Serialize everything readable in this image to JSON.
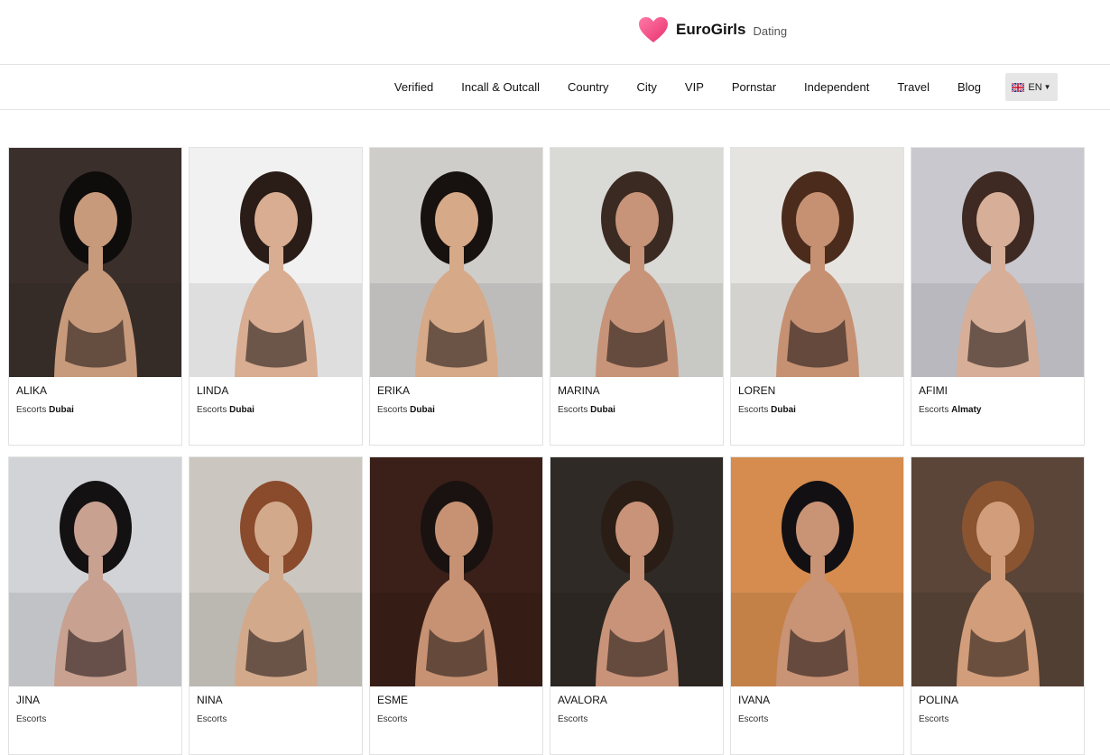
{
  "brand": {
    "name": "EuroGirls",
    "sub": "Dating"
  },
  "nav": {
    "items": [
      "Verified",
      "Incall & Outcall",
      "Country",
      "City",
      "VIP",
      "Pornstar",
      "Independent",
      "Travel",
      "Blog"
    ],
    "language": "EN"
  },
  "profiles": [
    {
      "name": "ALIKA",
      "prefix": "Escorts",
      "city": "Dubai",
      "bg": "#3a2f2b",
      "skin": "#c89a7c",
      "hair": "#0f0c0c"
    },
    {
      "name": "LINDA",
      "prefix": "Escorts",
      "city": "Dubai",
      "bg": "#f1f1f1",
      "skin": "#d8ad92",
      "hair": "#2a1c17"
    },
    {
      "name": "ERIKA",
      "prefix": "Escorts",
      "city": "Dubai",
      "bg": "#cfcdca",
      "skin": "#d6a988",
      "hair": "#17110f"
    },
    {
      "name": "MARINA",
      "prefix": "Escorts",
      "city": "Dubai",
      "bg": "#d9d9d6",
      "skin": "#c79479",
      "hair": "#3a2a22"
    },
    {
      "name": "LOREN",
      "prefix": "Escorts",
      "city": "Dubai",
      "bg": "#e6e4e0",
      "skin": "#c69173",
      "hair": "#4a2b1c"
    },
    {
      "name": "AFIMI",
      "prefix": "Escorts",
      "city": "Almaty",
      "bg": "#c9c8cf",
      "skin": "#d7ae97",
      "hair": "#3e2a22"
    },
    {
      "name": "JINA",
      "prefix": "Escorts",
      "city": "",
      "bg": "#d2d3d6",
      "skin": "#c9a191",
      "hair": "#141112"
    },
    {
      "name": "NINA",
      "prefix": "Escorts",
      "city": "",
      "bg": "#cbc7c0",
      "skin": "#d3a98c",
      "hair": "#8a4a2c"
    },
    {
      "name": "ESME",
      "prefix": "Escorts",
      "city": "",
      "bg": "#3a2018",
      "skin": "#c79273",
      "hair": "#1a1210"
    },
    {
      "name": "AVALORA",
      "prefix": "Escorts",
      "city": "",
      "bg": "#2f2a25",
      "skin": "#c89378",
      "hair": "#2a1d16"
    },
    {
      "name": "IVANA",
      "prefix": "Escorts",
      "city": "",
      "bg": "#d58c4e",
      "skin": "#c99376",
      "hair": "#121012"
    },
    {
      "name": "POLINA",
      "prefix": "Escorts",
      "city": "",
      "bg": "#5a4538",
      "skin": "#d29d7a",
      "hair": "#8a5430"
    }
  ]
}
